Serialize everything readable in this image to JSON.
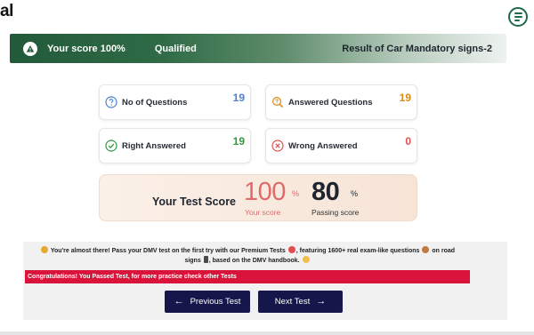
{
  "header": {
    "logo_fragment": "al",
    "menu_icon": "menu-circle-icon"
  },
  "banner": {
    "score_text": "Your score 100%",
    "status_text": "Qualified",
    "result_title": "Result of Car Mandatory signs-2",
    "icon": "warning-triangle-icon"
  },
  "stats": [
    {
      "label": "No of Questions",
      "value": "19",
      "icon": "question-circle-icon",
      "color": "#4a7fd1"
    },
    {
      "label": "Answered Questions",
      "value": "19",
      "icon": "search-question-icon",
      "color": "#d98a1a"
    },
    {
      "label": "Right Answered",
      "value": "19",
      "icon": "check-circle-icon",
      "color": "#2e9a3c"
    },
    {
      "label": "Wrong Answered",
      "value": "0",
      "icon": "x-circle-icon",
      "color": "#e05050"
    }
  ],
  "test_score": {
    "label": "Your Test Score",
    "your_value": "100",
    "your_unit": "%",
    "your_caption": "Your score",
    "passing_value": "80",
    "passing_unit": "%",
    "passing_caption": "Passing score"
  },
  "promo": {
    "part1": "You're almost there! Pass your DMV test on the first try with our Premium Tests",
    "part2": ", featuring 1600+ real exam-like questions",
    "part3": "on road signs",
    "part4": ", based on the DMV handbook.",
    "congrats": "Congratulations! You Passed Test, for more practice check other Tests"
  },
  "nav": {
    "previous_label": "Previous Test",
    "next_label": "Next Test"
  },
  "colors": {
    "accent_green": "#235a3a",
    "navy": "#15174a",
    "red": "#d9133a",
    "score_red": "#e06a6a"
  }
}
